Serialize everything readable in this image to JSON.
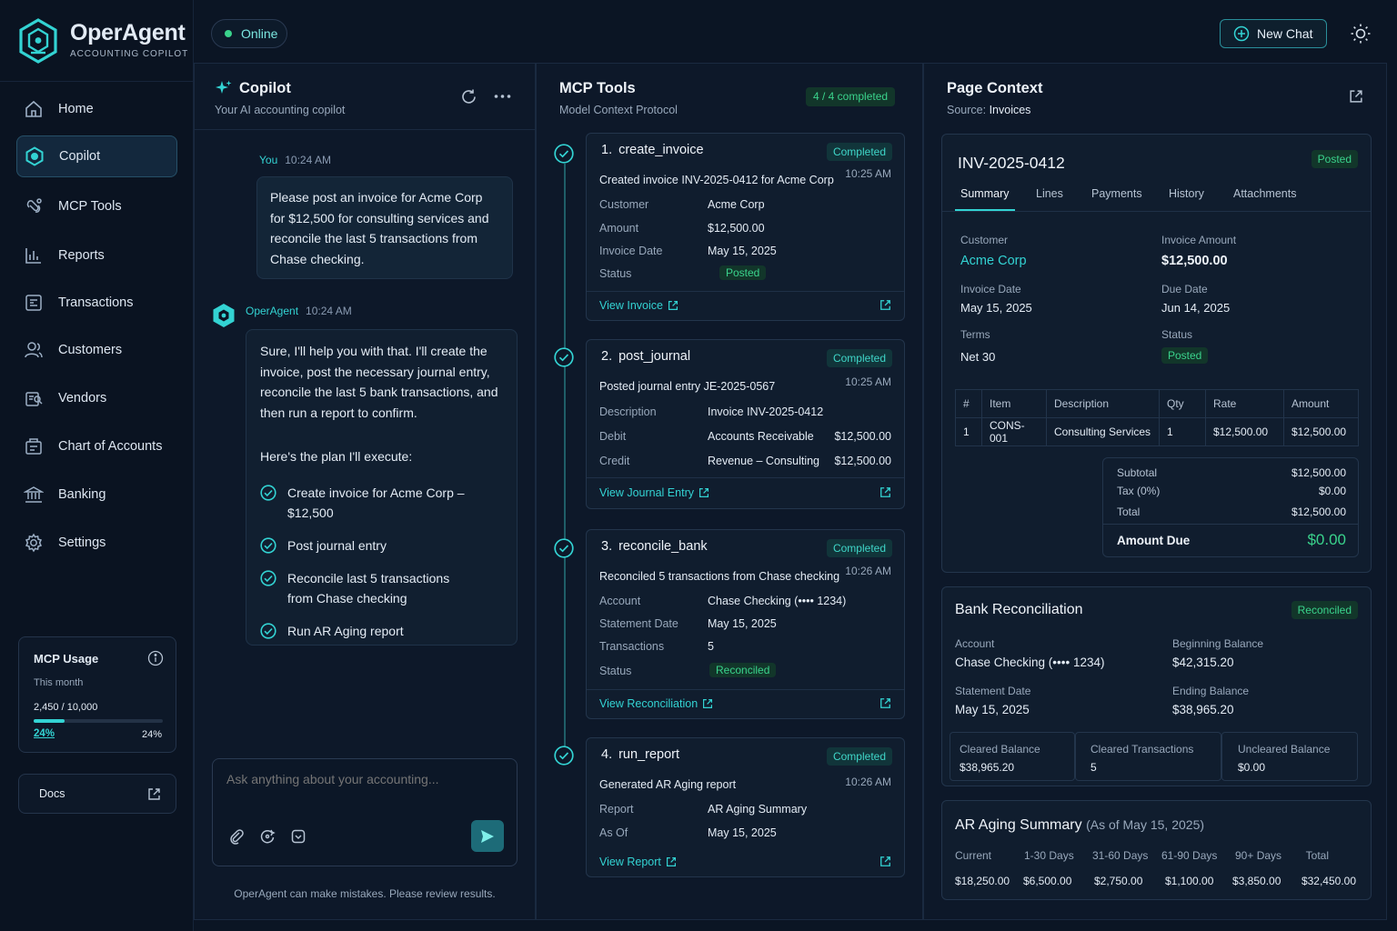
{
  "brand": {
    "name": "OperAgent",
    "tagline": "ACCOUNTING COPILOT"
  },
  "status": {
    "label": "Online"
  },
  "header": {
    "new_chat_label": "New Chat"
  },
  "sidebar": {
    "items": [
      {
        "label": "Home",
        "icon": "home-icon"
      },
      {
        "label": "Copilot",
        "icon": "copilot-icon",
        "active": true
      },
      {
        "label": "MCP Tools",
        "icon": "mcp-tools-icon"
      },
      {
        "label": "Reports",
        "icon": "reports-icon"
      },
      {
        "label": "Transactions",
        "icon": "transactions-icon"
      },
      {
        "label": "Customers",
        "icon": "customers-icon"
      },
      {
        "label": "Vendors",
        "icon": "vendors-icon"
      },
      {
        "label": "Chart of Accounts",
        "icon": "chart-of-accounts-icon"
      },
      {
        "label": "Banking",
        "icon": "bank-icon"
      },
      {
        "label": "Settings",
        "icon": "gear-icon"
      }
    ],
    "usage": {
      "title": "MCP Usage",
      "period": "This month",
      "count": "2,450 / 10,000",
      "percent_label": "24%",
      "percent_right": "24%",
      "fraction": 0.24
    },
    "docs_label": "Docs"
  },
  "copilot": {
    "title": "Copilot",
    "subtitle": "Your AI accounting copilot",
    "user_msg": {
      "author": "You",
      "time": "10:24 AM",
      "text": "Please post an invoice for Acme Corp for $12,500 for consulting services and reconcile the last 5 transactions from Chase checking."
    },
    "agent_msg": {
      "author": "OperAgent",
      "time": "10:24 AM",
      "text": "Sure, I'll help you with that. I'll create the invoice, post the necessary journal entry, reconcile the last 5 bank transactions, and then run a report to confirm.",
      "plan_intro": "Here's the plan I'll execute:",
      "plan": [
        "Create invoice for Acme Corp – $12,500",
        "Post journal entry",
        "Reconcile last 5 transactions from Chase checking",
        "Run AR Aging report"
      ]
    },
    "input_placeholder": "Ask anything about your accounting...",
    "disclaimer": "OperAgent can make mistakes. Please review results."
  },
  "mcp": {
    "title": "MCP Tools",
    "subtitle": "Model Context Protocol",
    "progress": "4 / 4 completed",
    "tools": [
      {
        "num": "1.",
        "name": "create_invoice",
        "status": "Completed",
        "summary": "Created invoice INV-2025-0412 for Acme Corp",
        "time": "10:25 AM",
        "rows": [
          {
            "k": "Customer",
            "v": "Acme Corp"
          },
          {
            "k": "Amount",
            "v": "$12,500.00"
          },
          {
            "k": "Invoice Date",
            "v": "May 15, 2025"
          },
          {
            "k": "Status",
            "v": "Posted"
          }
        ],
        "link": "View Invoice"
      },
      {
        "num": "2.",
        "name": "post_journal",
        "status": "Completed",
        "summary": "Posted journal entry JE-2025-0567",
        "time": "10:25 AM",
        "rows": [
          {
            "k": "Description",
            "v": "Invoice INV-2025-0412",
            "a": ""
          },
          {
            "k": "Debit",
            "v": "Accounts Receivable",
            "a": "$12,500.00"
          },
          {
            "k": "Credit",
            "v": "Revenue – Consulting",
            "a": "$12,500.00"
          }
        ],
        "link": "View Journal Entry"
      },
      {
        "num": "3.",
        "name": "reconcile_bank",
        "status": "Completed",
        "summary": "Reconciled 5 transactions from Chase checking",
        "time": "10:26 AM",
        "rows": [
          {
            "k": "Account",
            "v": "Chase Checking (•••• 1234)"
          },
          {
            "k": "Statement Date",
            "v": "May 15, 2025"
          },
          {
            "k": "Transactions",
            "v": "5"
          },
          {
            "k": "Status",
            "v": "Reconciled"
          }
        ],
        "link": "View Reconciliation"
      },
      {
        "num": "4.",
        "name": "run_report",
        "status": "Completed",
        "summary": "Generated AR Aging report",
        "time": "10:26 AM",
        "rows": [
          {
            "k": "Report",
            "v": "AR Aging Summary"
          },
          {
            "k": "As Of",
            "v": "May 15, 2025"
          }
        ],
        "link": "View Report"
      }
    ]
  },
  "context": {
    "title": "Page Context",
    "source_label": "Source:",
    "source": "Invoices",
    "invoice": {
      "number": "INV-2025-0412",
      "status": "Posted",
      "tabs": [
        "Summary",
        "Lines",
        "Payments",
        "History",
        "Attachments"
      ],
      "customer_label": "Customer",
      "customer": "Acme Corp",
      "amount_label": "Invoice Amount",
      "amount": "$12,500.00",
      "invoice_date_label": "Invoice Date",
      "invoice_date": "May 15, 2025",
      "due_date_label": "Due Date",
      "due_date": "Jun 14, 2025",
      "terms_label": "Terms",
      "terms": "Net 30",
      "status_label": "Status",
      "table_headers": [
        "#",
        "Item",
        "Description",
        "Qty",
        "Rate",
        "Amount"
      ],
      "table_rows": [
        [
          "1",
          "CONS-001",
          "Consulting Services",
          "1",
          "$12,500.00",
          "$12,500.00"
        ]
      ],
      "subtotal_label": "Subtotal",
      "subtotal": "$12,500.00",
      "tax_label": "Tax (0%)",
      "tax": "$0.00",
      "total_label": "Total",
      "total": "$12,500.00",
      "due_label": "Amount Due",
      "due": "$0.00"
    },
    "bank": {
      "title": "Bank Reconciliation",
      "status": "Reconciled",
      "account_label": "Account",
      "account": "Chase Checking (•••• 1234)",
      "beginning_label": "Beginning Balance",
      "beginning": "$42,315.20",
      "statement_label": "Statement Date",
      "statement": "May 15, 2025",
      "ending_label": "Ending Balance",
      "ending": "$38,965.20",
      "cleared_bal_label": "Cleared Balance",
      "cleared_bal": "$38,965.20",
      "cleared_tx_label": "Cleared Transactions",
      "cleared_tx": "5",
      "uncleared_label": "Uncleared Balance",
      "uncleared": "$0.00"
    },
    "aging": {
      "title": "AR Aging Summary",
      "asof": "(As of May 15, 2025)",
      "headers": [
        "Current",
        "1-30 Days",
        "31-60 Days",
        "61-90 Days",
        "90+ Days",
        "Total"
      ],
      "values": [
        "$18,250.00",
        "$6,500.00",
        "$2,750.00",
        "$1,100.00",
        "$3,850.00",
        "$32,450.00"
      ]
    }
  },
  "colors": {
    "accent": "#33d3d3",
    "success": "#3ad38c",
    "background": "#0b1524"
  }
}
